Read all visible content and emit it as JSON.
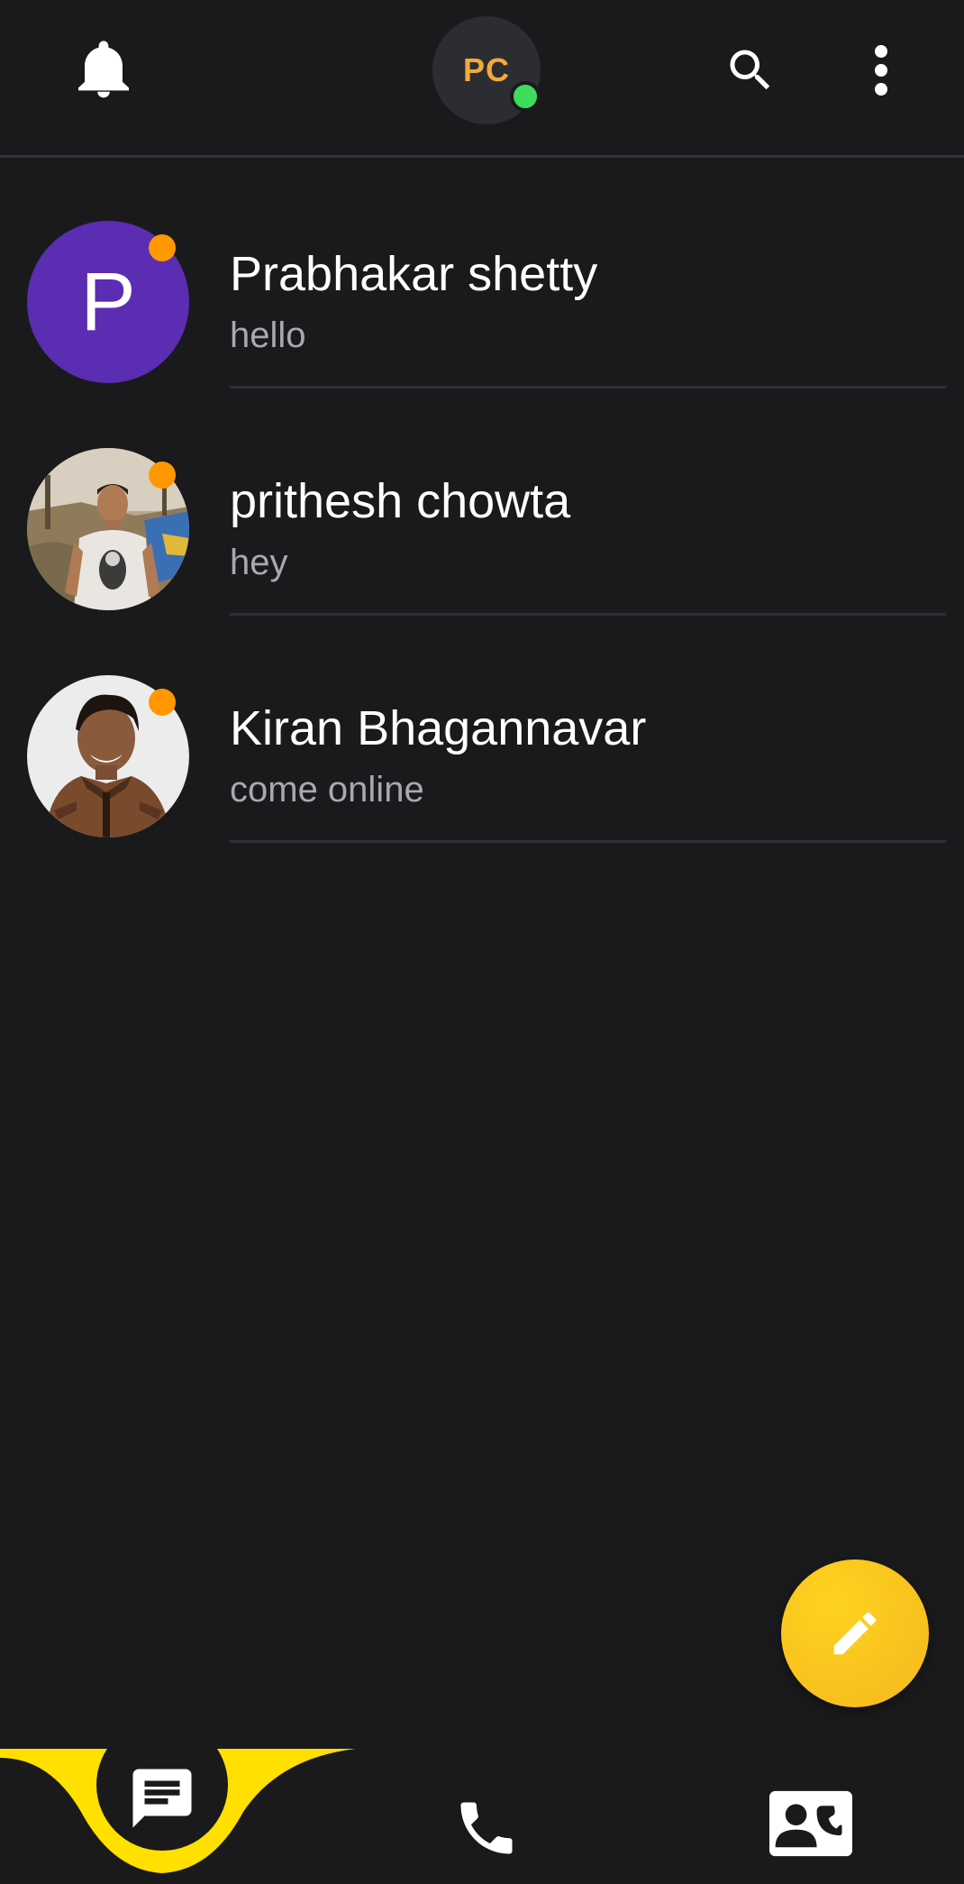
{
  "header": {
    "profile_initials": "PC",
    "profile_status": "online",
    "icons": [
      "bell-icon",
      "search-icon",
      "more-vert-icon"
    ]
  },
  "chats": [
    {
      "name": "Prabhakar shetty",
      "preview": "hello",
      "avatar_letter": "P",
      "avatar_type": "letter",
      "avatar_color": "#5b2db3",
      "status_color": "#ff9800"
    },
    {
      "name": "prithesh chowta",
      "preview": "hey",
      "avatar_type": "photo",
      "status_color": "#ff9800"
    },
    {
      "name": "Kiran Bhagannavar",
      "preview": "come online",
      "avatar_type": "photo",
      "status_color": "#ff9800"
    }
  ],
  "fab": {
    "icon": "pencil-icon",
    "color": "#f5c518"
  },
  "bottom_nav": {
    "active": "chats",
    "items": [
      {
        "id": "chats",
        "icon": "chat-icon"
      },
      {
        "id": "calls",
        "icon": "phone-icon"
      },
      {
        "id": "contacts",
        "icon": "contact-phone-icon"
      }
    ],
    "accent": "#ffe000"
  },
  "colors": {
    "background": "#1a1a1c",
    "initials": "#f2a93b",
    "online": "#3ddc5c",
    "preview_text": "#a8a8ad"
  }
}
